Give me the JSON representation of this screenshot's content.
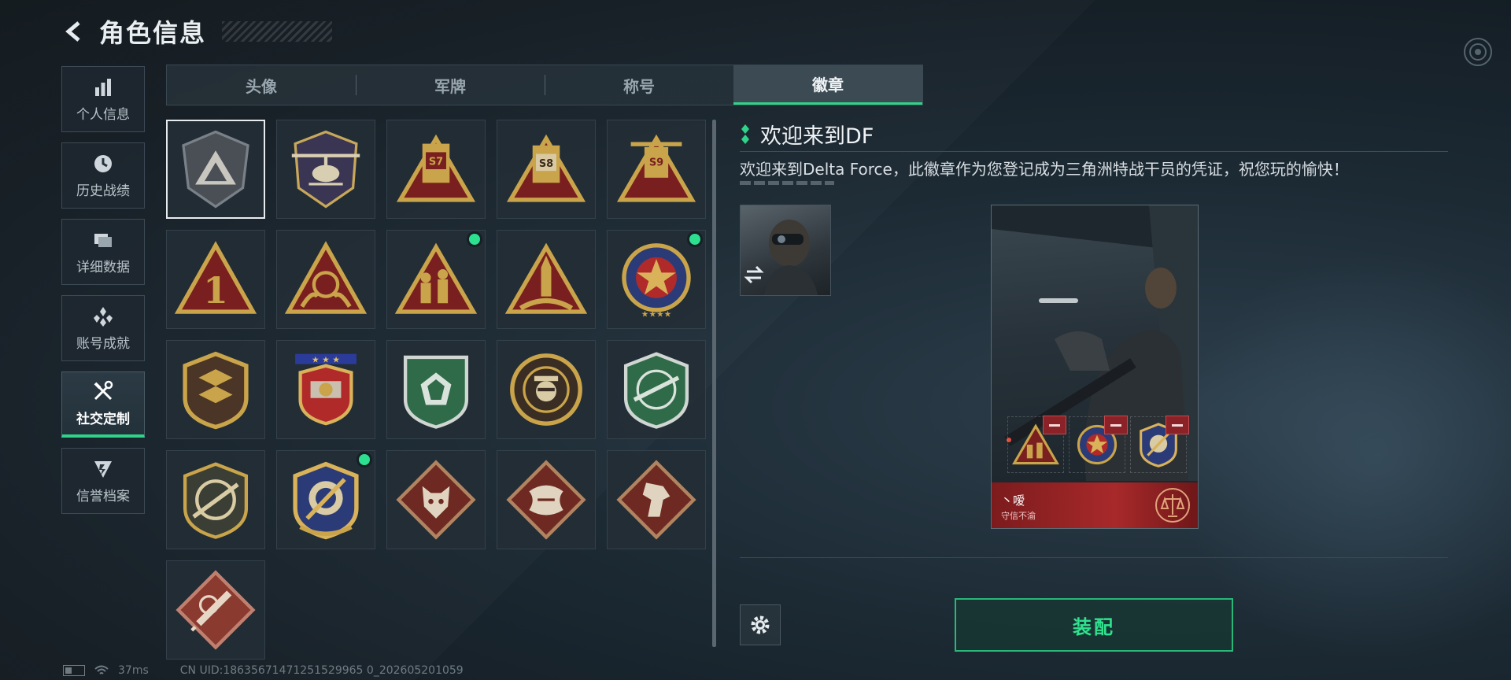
{
  "header": {
    "title": "角色信息"
  },
  "sidebar": {
    "items": [
      {
        "label": "个人信息",
        "icon": "bar-chart-icon",
        "active": false
      },
      {
        "label": "历史战绩",
        "icon": "history-clock-icon",
        "active": false
      },
      {
        "label": "详细数据",
        "icon": "folder-data-icon",
        "active": false
      },
      {
        "label": "账号成就",
        "icon": "achievement-icon",
        "active": false
      },
      {
        "label": "社交定制",
        "icon": "tools-icon",
        "active": true
      },
      {
        "label": "信誉档案",
        "icon": "reputation-icon",
        "active": false
      }
    ]
  },
  "tabs": [
    {
      "label": "头像",
      "active": false
    },
    {
      "label": "军牌",
      "active": false
    },
    {
      "label": "称号",
      "active": false
    },
    {
      "label": "徽章",
      "active": true
    }
  ],
  "badges": [
    {
      "name": "delta-logo-badge",
      "selected": true,
      "new": false
    },
    {
      "name": "helicopter-badge",
      "selected": false,
      "new": false
    },
    {
      "name": "s7-badge",
      "selected": false,
      "new": false,
      "text": "S7"
    },
    {
      "name": "s8-badge",
      "selected": false,
      "new": false,
      "text": "S8"
    },
    {
      "name": "s9-badge",
      "selected": false,
      "new": false,
      "text": "S9"
    },
    {
      "name": "number-one-badge",
      "selected": false,
      "new": false,
      "text": "1"
    },
    {
      "name": "hands-gem-badge",
      "selected": false,
      "new": false
    },
    {
      "name": "soldiers-badge",
      "selected": false,
      "new": true
    },
    {
      "name": "rocket-badge",
      "selected": false,
      "new": false
    },
    {
      "name": "star-medal-badge",
      "selected": false,
      "new": true
    },
    {
      "name": "shield-emblem-badge",
      "selected": false,
      "new": false
    },
    {
      "name": "laurel-shield-badge",
      "selected": false,
      "new": false
    },
    {
      "name": "green-gem-badge",
      "selected": false,
      "new": false
    },
    {
      "name": "skull-crosshair-badge",
      "selected": false,
      "new": false
    },
    {
      "name": "green-rifle-badge",
      "selected": false,
      "new": false
    },
    {
      "name": "rifle-crosshair-badge",
      "selected": false,
      "new": false
    },
    {
      "name": "knife-crosshair-badge",
      "selected": false,
      "new": true
    },
    {
      "name": "wolf-badge",
      "selected": false,
      "new": false
    },
    {
      "name": "dragon-badge",
      "selected": false,
      "new": false
    },
    {
      "name": "horse-badge",
      "selected": false,
      "new": false
    },
    {
      "name": "syringe-badge",
      "selected": false,
      "new": false
    }
  ],
  "detail": {
    "title": "欢迎来到DF",
    "description": "欢迎来到Delta Force，此徽章作为您登记成为三角洲特战干员的凭证，祝您玩的愉快！"
  },
  "card": {
    "player_name": "丶嗳",
    "subtitle": "守信不渝"
  },
  "actions": {
    "equip_label": "装配"
  },
  "status": {
    "ping": "37ms",
    "uid": "CN UID:18635671471251529965 0_202605201059"
  },
  "colors": {
    "accent": "#2fd38a",
    "new_dot": "#2de08f",
    "card_footer": "#a8292a"
  }
}
